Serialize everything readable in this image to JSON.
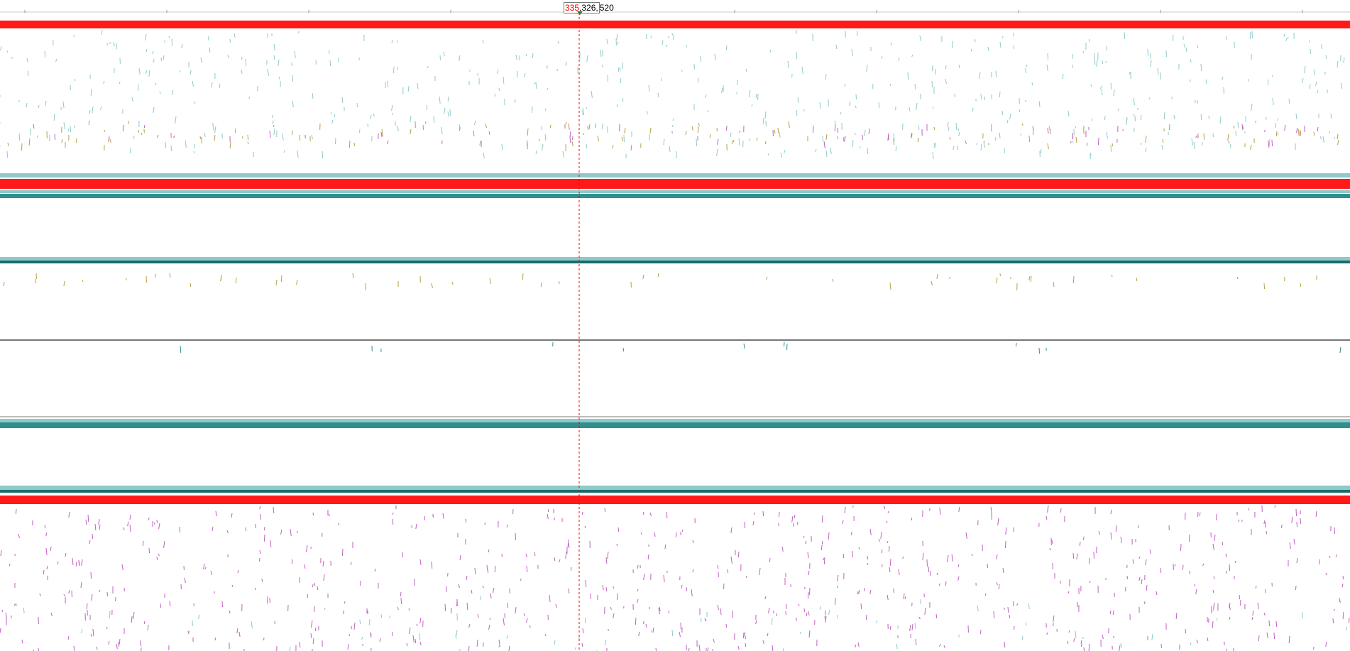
{
  "position_readout": {
    "prefix": "335",
    "middle": ",326,",
    "suffix": "520"
  },
  "colors": {
    "selection_red": "#ff1a1a",
    "coverage_teal": "#2f8f8f",
    "light_teal": "#8fc9c9",
    "dark_teal": "#1a6b6b",
    "magenta_marks": "#c060c0",
    "olive_marks": "#b5a040",
    "cursor_line": "#ff0000"
  }
}
